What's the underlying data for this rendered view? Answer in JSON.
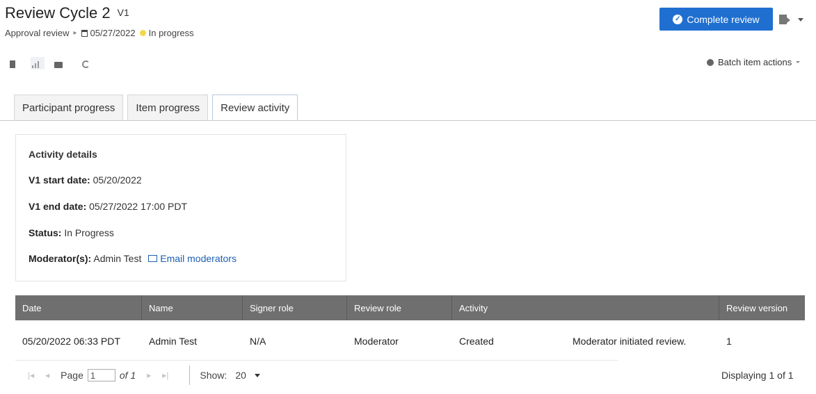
{
  "header": {
    "title": "Review Cycle 2",
    "version": "V1",
    "review_type": "Approval review",
    "due_date": "05/27/2022",
    "status": "In progress",
    "status_color": "#f3d74a"
  },
  "actions": {
    "complete_review_label": "Complete review",
    "batch_item_actions_label": "Batch item actions",
    "primary_color": "#1f6fd0"
  },
  "toolbar": {
    "icons": [
      "document-view-icon",
      "bars-view-icon",
      "comment-view-icon",
      "refresh-icon"
    ]
  },
  "tabs": [
    {
      "label": "Participant progress",
      "active": false
    },
    {
      "label": "Item progress",
      "active": false
    },
    {
      "label": "Review activity",
      "active": true
    }
  ],
  "activity_details": {
    "heading": "Activity details",
    "start_date_label": "V1 start date:",
    "start_date_value": "05/20/2022",
    "end_date_label": "V1 end date:",
    "end_date_value": "05/27/2022 17:00 PDT",
    "status_label": "Status:",
    "status_value": "In Progress",
    "moderators_label": "Moderator(s):",
    "moderators_value": "Admin Test",
    "email_link": "Email moderators"
  },
  "table": {
    "columns": [
      "Date",
      "Name",
      "Signer role",
      "Review role",
      "Activity",
      "Review version"
    ],
    "rows": [
      {
        "date": "05/20/2022 06:33 PDT",
        "name": "Admin Test",
        "signer_role": "N/A",
        "review_role": "Moderator",
        "activity": "Created",
        "activity_note": "Moderator initiated review.",
        "review_version": "1"
      }
    ]
  },
  "pagination": {
    "page_label": "Page",
    "page_value": "1",
    "of_label": "of 1",
    "show_label": "Show:",
    "show_value": "20",
    "displaying": "Displaying 1 of 1"
  }
}
